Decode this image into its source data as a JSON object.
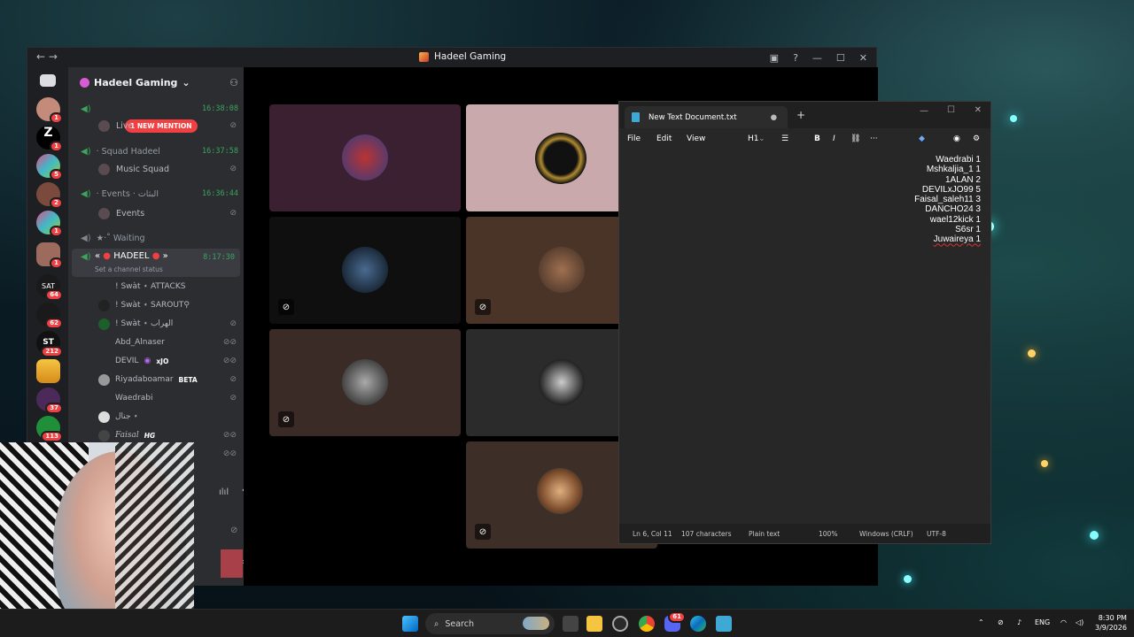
{
  "discord": {
    "window_title": "Hadeel Gaming",
    "server_name": "Hadeel Gaming",
    "server_badges": [
      "1",
      "1",
      "5",
      "2",
      "1",
      "1",
      "64",
      "62",
      "212",
      "",
      "37",
      "113"
    ],
    "mention_pill": "1 NEW MENTION",
    "voice_channels": [
      {
        "name": "",
        "time": "16:38:08",
        "sub": "Live"
      },
      {
        "name": "· Squad Hadeel",
        "time": "16:37:58",
        "sub": "Music Squad"
      },
      {
        "name": "· Events · البثات",
        "time": "16:36:44",
        "sub": "Events"
      }
    ],
    "waiting_label": "★·˚ Waiting",
    "active_channel": {
      "name": "HADEEL",
      "time": "8:17:30",
      "status": "Set a channel status"
    },
    "members": [
      "! Swàt ⋆ ATTACKS",
      "! Swàt ⋆ SAROUT⚲",
      "! Swàt ⋆ الهراب",
      "Abd_Alnaser",
      "DEVIL",
      "Riyadaboamar",
      "Waedrabi",
      "جنال ⋆",
      "Faisal"
    ],
    "member_tags": {
      "devil": "xJO",
      "riyad": "BETA",
      "faisal": "HG"
    }
  },
  "notepad": {
    "tab_title": "New Text Document.txt",
    "menu": [
      "File",
      "Edit",
      "View"
    ],
    "heading": "H1",
    "lines": [
      "Waedrabi 1",
      "Mshkaljia_1 1",
      "1ALAN 2",
      "DEVILxJO99 5",
      "Faisal_saleh11 3",
      "DANCHO24 3",
      "wael12kick 1",
      "S6sr 1",
      "Juwaireya 1"
    ],
    "status": {
      "position": "Ln 6, Col 11",
      "chars": "107 characters",
      "mode": "Plain text",
      "zoom": "100%",
      "eol": "Windows (CRLF)",
      "encoding": "UTF-8"
    }
  },
  "taskbar": {
    "search": "Search",
    "lang": "ENG",
    "time": "8:30 PM",
    "date": "3/9/2026",
    "discord_badge": "61"
  },
  "colors": {
    "discord_bg": "#2b2d31",
    "accent_red": "#f23f42",
    "online_green": "#3ba55c"
  }
}
